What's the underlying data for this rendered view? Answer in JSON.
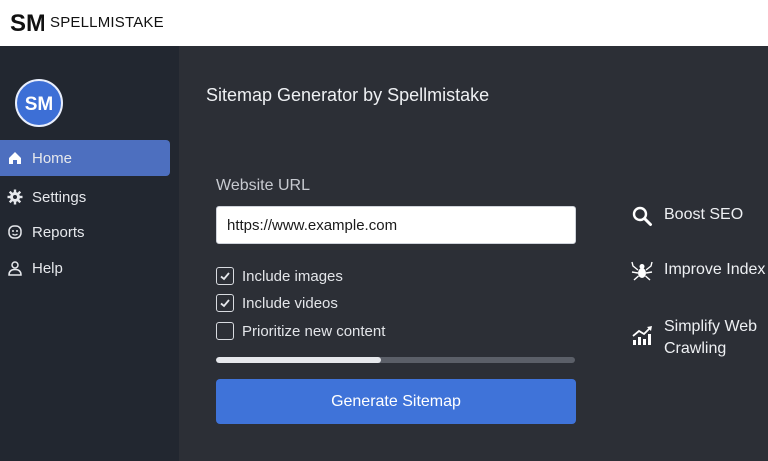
{
  "header": {
    "brand_logo_text": "SM",
    "brand_name": "SPELLMISTAKE"
  },
  "sidebar": {
    "avatar_text": "SM",
    "items": [
      {
        "label": "Home",
        "icon": "home-icon",
        "active": true
      },
      {
        "label": "Settings",
        "icon": "gear-icon",
        "active": false
      },
      {
        "label": "Reports",
        "icon": "reports-icon",
        "active": false
      },
      {
        "label": "Help",
        "icon": "user-icon",
        "active": false
      }
    ]
  },
  "main": {
    "title": "Sitemap Generator by Spellmistake",
    "url_label": "Website URL",
    "url_value": "https://www.example.com",
    "options": [
      {
        "label": "Include images",
        "checked": true
      },
      {
        "label": "Include videos",
        "checked": true
      },
      {
        "label": "Prioritize new content",
        "checked": false
      }
    ],
    "progress_percent": 46,
    "generate_button_label": "Generate Sitemap"
  },
  "features": [
    {
      "icon": "search-icon",
      "line1": "Boost SEO",
      "line2": ""
    },
    {
      "icon": "spider-icon",
      "line1": "Improve Index",
      "line2": ""
    },
    {
      "icon": "trend-chart-icon",
      "line1": "Simplify Web",
      "line2": "Crawling"
    }
  ],
  "colors": {
    "accent": "#3f73d9",
    "sidebar_bg": "#222730",
    "main_bg": "#2c2f36",
    "active_nav": "#4d6fbf"
  }
}
